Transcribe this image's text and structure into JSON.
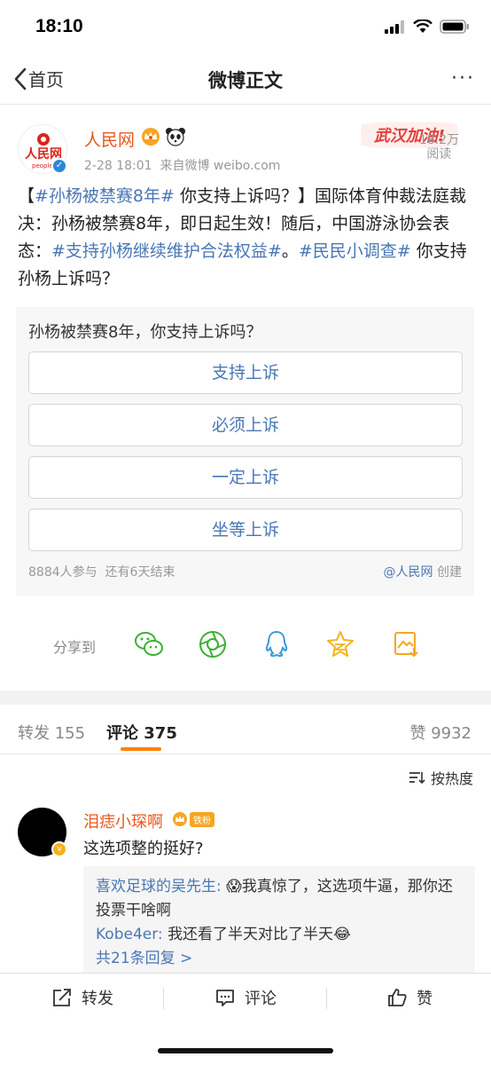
{
  "status": {
    "time": "18:10"
  },
  "nav": {
    "back_label": "首页",
    "title": "微博正文",
    "more": "···"
  },
  "post": {
    "author": "人民网",
    "avatar_text": "人民网",
    "avatar_subtext": "people.",
    "time": "2-28 18:01",
    "source": "来自微博 weibo.com",
    "stamp_text": "武汉加油!",
    "reads_count": "18.2万",
    "reads_label": "阅读",
    "text": {
      "p1": "【",
      "tag1": "#孙杨被禁赛8年#",
      "p2": " 你支持上诉吗？】国际体育仲裁法庭裁决：孙杨被禁赛8年，即日起生效！随后，中国游泳协会表态：",
      "tag2": "#支持孙杨继续维护合法权益#",
      "p3": "。",
      "tag3": "#民民小调查#",
      "p4": " 你支持孙杨上诉吗？"
    }
  },
  "poll": {
    "question": "孙杨被禁赛8年，你支持上诉吗？",
    "options": [
      "支持上诉",
      "必须上诉",
      "一定上诉",
      "坐等上诉"
    ],
    "participants": "8884人参与",
    "remaining": "还有6天结束",
    "creator_link": "@人民网",
    "creator_suffix": "创建"
  },
  "share": {
    "label": "分享到",
    "targets": [
      "wechat-icon",
      "moments-icon",
      "qq-icon",
      "qzone-icon",
      "save-image-icon"
    ]
  },
  "tabs": {
    "reposts": "转发 155",
    "comments": "评论 375",
    "likes": "赞 9932",
    "accent": "#ff8200"
  },
  "sort": {
    "label": "按热度"
  },
  "comment": {
    "author": "泪痣小琛啊",
    "badge": "铁粉",
    "text": "这选项整的挺好?",
    "replies": [
      {
        "name": "喜欢足球的吴先生:",
        "emoji": "😱",
        "text": "我真惊了，这选项牛逼，那你还投票干啥啊"
      },
      {
        "name": "Kobe4er:",
        "text": "我还看了半天对比了半天",
        "emoji": "😂"
      }
    ],
    "more": "共21条回复 >"
  },
  "bottom_bar": {
    "repost": "转发",
    "comment": "评论",
    "like": "赞"
  },
  "colors": {
    "link": "#4a77b5",
    "name": "#e8581d",
    "accent": "#ff8200"
  }
}
